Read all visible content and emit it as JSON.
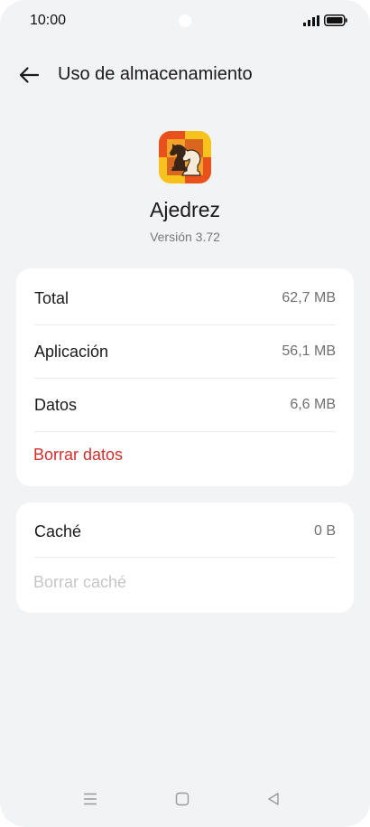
{
  "status_bar": {
    "time": "10:00",
    "signal_icon": "signal-icon",
    "battery_icon": "battery-icon"
  },
  "header": {
    "back_icon": "arrow-left-icon",
    "title": "Uso de almacenamiento"
  },
  "app": {
    "icon": "chess-knight-icon",
    "name": "Ajedrez",
    "version": "Versión 3.72"
  },
  "storage": {
    "rows": [
      {
        "label": "Total",
        "value": "62,7 MB"
      },
      {
        "label": "Aplicación",
        "value": "56,1 MB"
      },
      {
        "label": "Datos",
        "value": "6,6 MB"
      }
    ],
    "action_label": "Borrar datos"
  },
  "cache": {
    "label": "Caché",
    "value": "0 B",
    "action_label": "Borrar caché"
  },
  "nav_bar": {
    "icons": [
      "menu-icon",
      "home-icon",
      "back-triangle-icon"
    ]
  },
  "colors": {
    "background": "#f2f3f5",
    "card": "#ffffff",
    "danger": "#d2302f",
    "disabled": "#c6c6c6"
  }
}
